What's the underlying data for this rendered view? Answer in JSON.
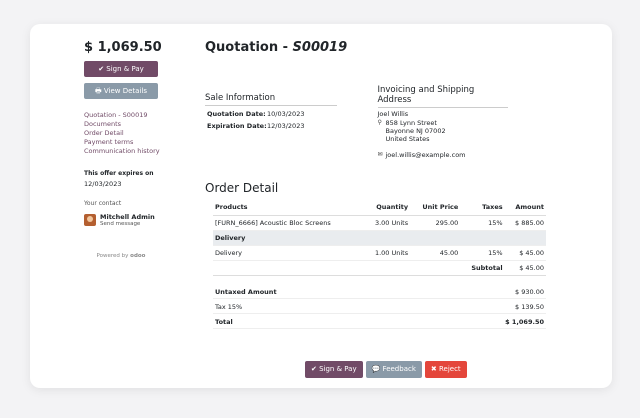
{
  "sidebar": {
    "total": "$ 1,069.50",
    "sign_pay_label": "✔ Sign & Pay",
    "view_details_label": "🖶 View Details",
    "links": [
      {
        "label": "Quotation - S00019"
      },
      {
        "label": "Documents"
      },
      {
        "label": "Order Detail"
      },
      {
        "label": "Payment terms"
      },
      {
        "label": "Communication history"
      }
    ],
    "expiry_label": "This offer expires on",
    "expiry_date": "12/03/2023",
    "contact_label": "Your contact",
    "contact_name": "Mitchell Admin",
    "contact_action": "Send message",
    "powered_by": "Powered by",
    "powered_brand": "odoo"
  },
  "main": {
    "title_prefix": "Quotation - ",
    "title_ref": "S00019",
    "sale_info_title": "Sale Information",
    "quotation_date_label": "Quotation Date:",
    "quotation_date": "10/03/2023",
    "expiration_date_label": "Expiration Date:",
    "expiration_date": "12/03/2023",
    "address_title": "Invoicing and Shipping Address",
    "customer_name": "Joel Willis",
    "address_line1": "858 Lynn Street",
    "address_line2": "Bayonne NJ 07002",
    "address_line3": "United States",
    "email": "joel.willis@example.com",
    "order_title": "Order Detail",
    "table": {
      "headers": {
        "products": "Products",
        "quantity": "Quantity",
        "unit_price": "Unit Price",
        "taxes": "Taxes",
        "amount": "Amount"
      },
      "rows": [
        {
          "product": "[FURN_6666] Acoustic Bloc Screens",
          "quantity": "3.00 Units",
          "unit_price": "295.00",
          "taxes": "15%",
          "amount": "$ 885.00"
        }
      ],
      "section": "Delivery",
      "delivery_row": {
        "product": "Delivery",
        "quantity": "1.00 Units",
        "unit_price": "45.00",
        "taxes": "15%",
        "amount": "$ 45.00"
      },
      "subtotal_label": "Subtotal",
      "subtotal_value": "$ 45.00"
    },
    "totals": {
      "untaxed_label": "Untaxed Amount",
      "untaxed_value": "$ 930.00",
      "tax_label": "Tax 15%",
      "tax_value": "$ 139.50",
      "total_label": "Total",
      "total_value": "$ 1,069.50"
    }
  },
  "bottom_bar": {
    "sign_pay": "✔ Sign & Pay",
    "feedback": "💬 Feedback",
    "reject": "✖ Reject"
  },
  "colors": {
    "primary": "#714b67",
    "secondary": "#8a9aa8",
    "danger": "#e4463b"
  }
}
